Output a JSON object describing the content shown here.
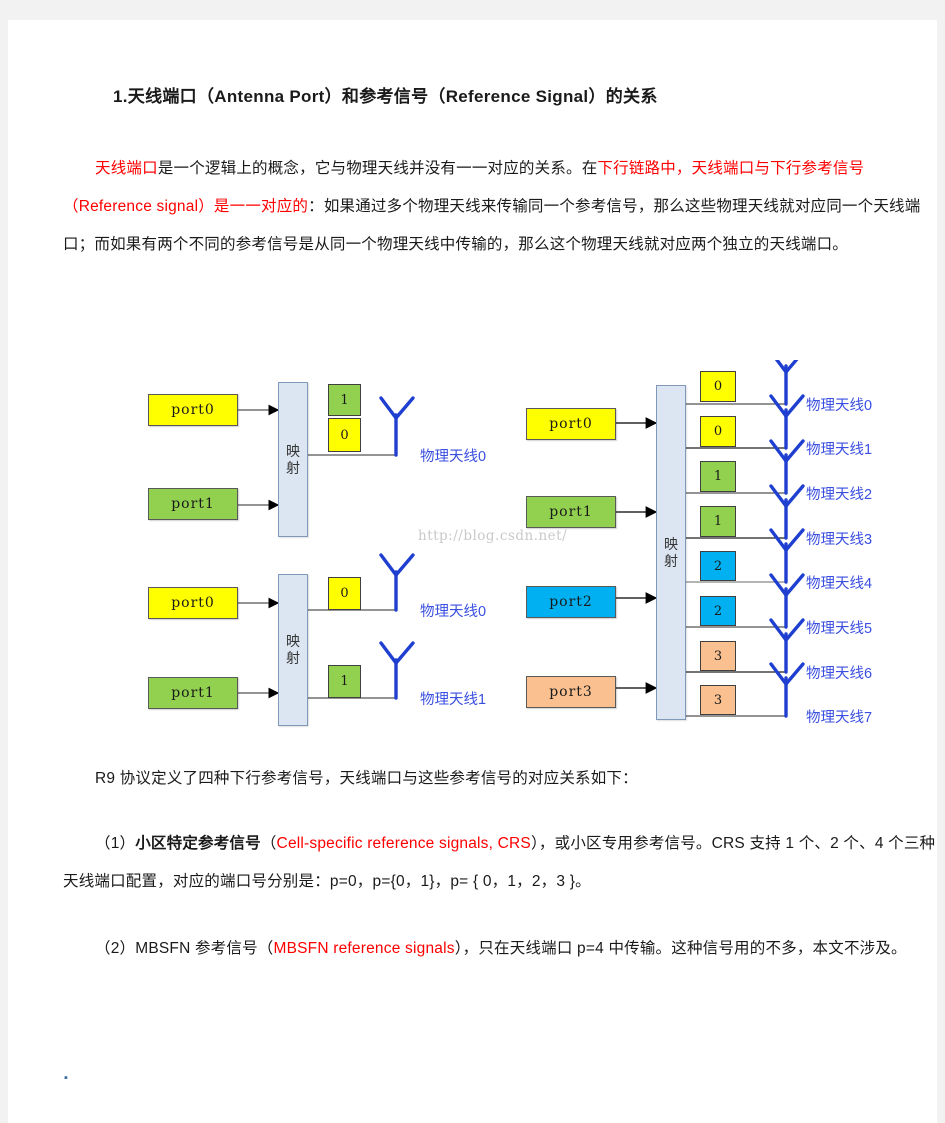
{
  "document": {
    "heading": "1.天线端口（Antenna Port）和参考信号（Reference Signal）的关系",
    "paragraph1": {
      "seg1_red": "天线端口",
      "seg2": "是一个逻辑上的概念，它与物理天线并没有一一对应的关系。在",
      "seg3_red": "下行链路中，天线端口与下行参考信号（Reference signal）是一一对应的",
      "seg4": "：如果通过多个物理天线来传输同一个参考信号，那么这些物理天线就对应同一个天线端口；而如果有两个不同的参考信号是从同一个物理天线中传输的，那么这个物理天线就对应两个独立的天线端口。"
    },
    "paragraph2": "R9 协议定义了四种下行参考信号，天线端口与这些参考信号的对应关系如下：",
    "paragraph3": {
      "seg1": "（1）",
      "seg2_bold": "小区特定参考信号",
      "seg3": "（",
      "seg4_red": "Cell-specific reference signals, CRS",
      "seg5": "），或小区专用参考信号。CRS 支持 1 个、2 个、4 个三种天线端口配置，对应的端口号分别是：p=0，p={0，1}，p= { 0，1，2，3 }。"
    },
    "paragraph4": {
      "seg1": "（2）MBSFN 参考信号（",
      "seg2_red": "MBSFN reference signals",
      "seg3": "），只在天线端口 p=4 中传输。这种信号用的不多，本文不涉及。"
    },
    "trailing_mark": "▪"
  },
  "figure": {
    "watermark": "http://blog.csdn.net/",
    "mapping_label_line1": "映",
    "mapping_label_line2": "射",
    "diagram_a": {
      "ports": [
        {
          "label": "port0",
          "color": "yellow"
        },
        {
          "label": "port1",
          "color": "green"
        }
      ],
      "signals": [
        {
          "value": "1",
          "color": "green"
        },
        {
          "value": "0",
          "color": "yellow"
        }
      ],
      "antennas": [
        {
          "label": "物理天线0"
        }
      ]
    },
    "diagram_b": {
      "ports": [
        {
          "label": "port0",
          "color": "yellow"
        },
        {
          "label": "port1",
          "color": "green"
        }
      ],
      "signals": [
        {
          "value": "0",
          "color": "yellow"
        },
        {
          "value": "1",
          "color": "green"
        }
      ],
      "antennas": [
        {
          "label": "物理天线0"
        },
        {
          "label": "物理天线1"
        }
      ]
    },
    "diagram_c": {
      "ports": [
        {
          "label": "port0",
          "color": "yellow"
        },
        {
          "label": "port1",
          "color": "green"
        },
        {
          "label": "port2",
          "color": "cyan"
        },
        {
          "label": "port3",
          "color": "peach"
        }
      ],
      "signals": [
        {
          "value": "0",
          "color": "yellow"
        },
        {
          "value": "0",
          "color": "yellow"
        },
        {
          "value": "1",
          "color": "green"
        },
        {
          "value": "1",
          "color": "green"
        },
        {
          "value": "2",
          "color": "cyan"
        },
        {
          "value": "2",
          "color": "cyan"
        },
        {
          "value": "3",
          "color": "peach"
        },
        {
          "value": "3",
          "color": "peach"
        }
      ],
      "antennas": [
        {
          "label": "物理天线0"
        },
        {
          "label": "物理天线1"
        },
        {
          "label": "物理天线2"
        },
        {
          "label": "物理天线3"
        },
        {
          "label": "物理天线4"
        },
        {
          "label": "物理天线5"
        },
        {
          "label": "物理天线6"
        },
        {
          "label": "物理天线7"
        }
      ]
    }
  },
  "colors": {
    "red": "#ff0000",
    "antenna_blue": "#1f3fd0",
    "label_blue": "#3a4fe0",
    "yellow": "#ffff00",
    "green": "#92d050",
    "cyan": "#00b0f0",
    "peach": "#fac090",
    "mapbox": "#dce6f2",
    "page_bg": "#f2f2f2"
  }
}
